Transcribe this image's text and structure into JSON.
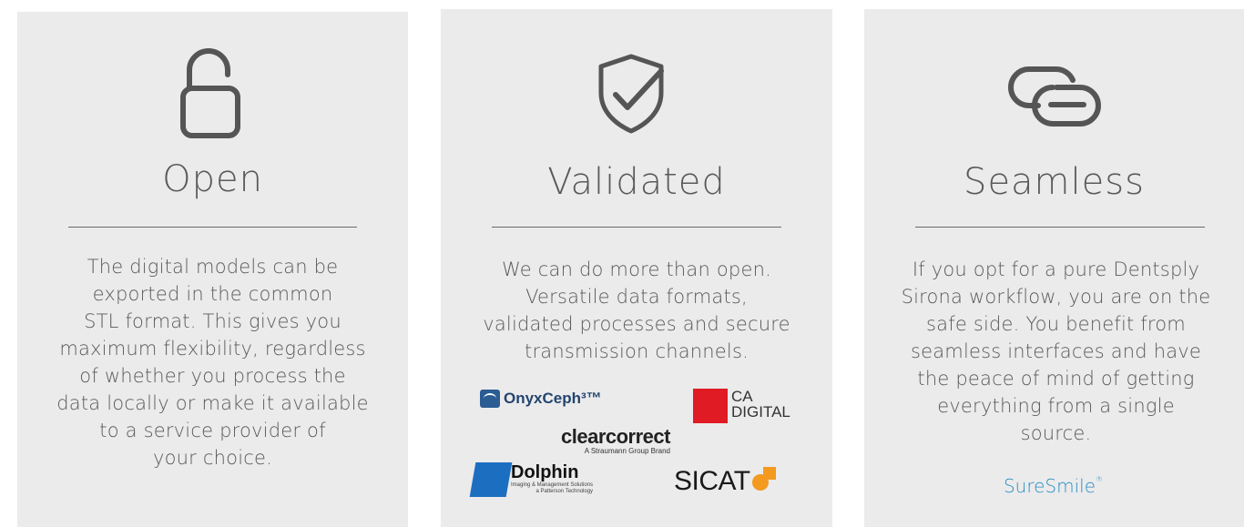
{
  "cards": [
    {
      "icon": "unlocked-padlock-icon",
      "title": "Open",
      "body": [
        "The digital models can be",
        "exported in the common",
        "STL format. This gives you",
        "maximum flexibility, regardless",
        "of whether you process the",
        "data locally or make it available",
        "to a service provider of",
        "your choice."
      ]
    },
    {
      "icon": "shield-check-icon",
      "title": "Validated",
      "body": [
        "We can do more than open.",
        "Versatile data formats,",
        "validated processes and secure",
        "transmission channels."
      ],
      "partners": {
        "onyxceph": "OnyxCeph³™",
        "cadigital_line1": "CA",
        "cadigital_line2": "DIGITAL",
        "clearcorrect": "clearcorrect",
        "clearcorrect_tagline": "A Straumann Group Brand",
        "dolphin": "Dolphin",
        "dolphin_sub1": "Imaging & Management Solutions",
        "dolphin_sub2": "a Patterson Technology",
        "sicat": "SICAT"
      }
    },
    {
      "icon": "linked-loops-icon",
      "title": "Seamless",
      "body": [
        "If you opt for a pure Dentsply",
        "Sirona workflow, you are on the",
        "safe side. You benefit from",
        "seamless interfaces and have",
        "the peace of mind of getting",
        "everything from a single",
        "source."
      ],
      "brand": "SureSmile",
      "brand_mark": "®"
    }
  ],
  "colors": {
    "card_bg": "#ebebec",
    "text": "#5a5a5a",
    "icon": "#555555",
    "suresmile_blue": "#2a8ec2"
  }
}
